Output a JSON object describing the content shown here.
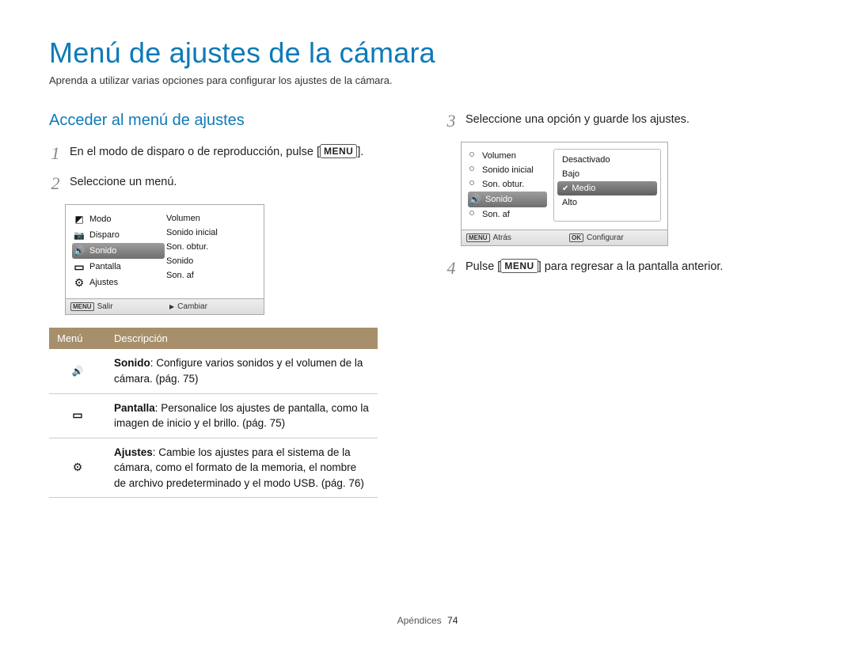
{
  "page_title": "Menú de ajustes de la cámara",
  "page_sub": "Aprenda a utilizar varias opciones para configurar los ajustes de la cámara.",
  "section_heading": "Acceder al menú de ajustes",
  "menu_button": "MENU",
  "steps": {
    "s1_pre": "En el modo de disparo o de reproducción, pulse [",
    "s1_post": "].",
    "s2": "Seleccione un menú.",
    "s3": "Seleccione una opción y guarde los ajustes.",
    "s4_pre": "Pulse [",
    "s4_post": "] para regresar a la pantalla anterior."
  },
  "cam1": {
    "left": [
      {
        "icon": "mode",
        "label": "Modo"
      },
      {
        "icon": "camera",
        "label": "Disparo"
      },
      {
        "icon": "speaker",
        "label": "Sonido",
        "selected": true
      },
      {
        "icon": "screen",
        "label": "Pantalla"
      },
      {
        "icon": "gear",
        "label": "Ajustes"
      }
    ],
    "right": [
      "Volumen",
      "Sonido inicial",
      "Son. obtur.",
      "Sonido",
      "Son. af"
    ],
    "foot_left_label": "Salir",
    "foot_left_tag": "MENU",
    "foot_right_label": "Cambiar"
  },
  "table": {
    "h1": "Menú",
    "h2": "Descripción",
    "rows": [
      {
        "icon": "speaker",
        "bold": "Sonido",
        "text": ": Configure varios sonidos y el volumen de la cámara. (pág. 75)"
      },
      {
        "icon": "screen",
        "bold": "Pantalla",
        "text": ": Personalice los ajustes de pantalla, como la imagen de inicio y el brillo. (pág. 75)"
      },
      {
        "icon": "gear",
        "bold": "Ajustes",
        "text": ": Cambie los ajustes para el sistema de la cámara, como el formato de la memoria, el nombre de archivo predeterminado y el modo USB. (pág. 76)"
      }
    ]
  },
  "cam2": {
    "left": [
      {
        "label": "Volumen"
      },
      {
        "label": "Sonido inicial"
      },
      {
        "label": "Son. obtur."
      },
      {
        "icon": "speaker",
        "label": "Sonido",
        "selected": true
      },
      {
        "label": "Son. af"
      }
    ],
    "right": [
      {
        "label": "Desactivado"
      },
      {
        "label": "Bajo"
      },
      {
        "label": "Medio",
        "selected": true
      },
      {
        "label": "Alto"
      }
    ],
    "foot_left_label": "Atrás",
    "foot_left_tag": "MENU",
    "foot_right_label": "Configurar"
  },
  "footer": {
    "section": "Apéndices",
    "page": "74"
  }
}
